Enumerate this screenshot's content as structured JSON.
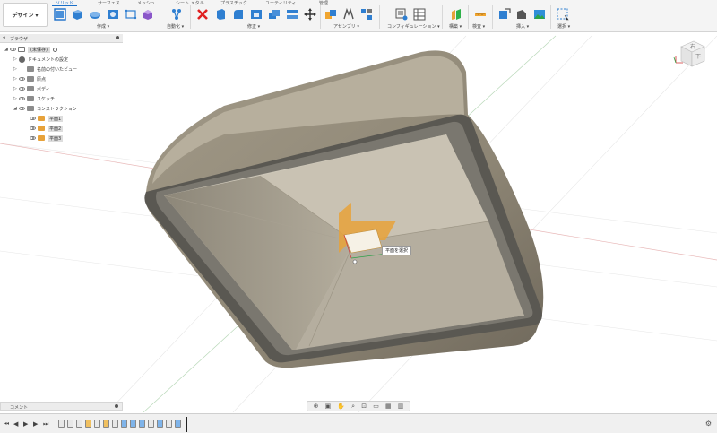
{
  "toolbar": {
    "workspace_label": "デザイン ▾",
    "tabs": [
      "ソリッド",
      "サーフェス",
      "メッシュ",
      "シート メタル",
      "プラスチック",
      "ユーティリティ",
      "管理"
    ],
    "groups": [
      "作成 ▾",
      "自動化 ▾",
      "修正 ▾",
      "アセンブリ ▾",
      "コンフィギュレーション ▾",
      "構築 ▾",
      "検査 ▾",
      "挿入 ▾",
      "選択 ▾"
    ],
    "accent": "#1a6fc9"
  },
  "browser": {
    "title": "ブラウザ",
    "items": [
      {
        "label": "(未保存)",
        "icon": "component-icon"
      },
      {
        "label": "ドキュメントの設定",
        "icon": "gear-icon"
      },
      {
        "label": "名前の付いたビュー",
        "icon": "folder-icon"
      },
      {
        "label": "原点",
        "icon": "folder-icon"
      },
      {
        "label": "ボディ",
        "icon": "folder-icon"
      },
      {
        "label": "スケッチ",
        "icon": "folder-icon"
      },
      {
        "label": "コンストラクション",
        "icon": "folder-icon"
      },
      {
        "label": "平面1",
        "icon": "plane-icon"
      },
      {
        "label": "平面2",
        "icon": "plane-icon"
      },
      {
        "label": "平面3",
        "icon": "plane-icon"
      }
    ]
  },
  "comments": {
    "label": "コメント"
  },
  "tooltip": {
    "text": "平面を選択"
  },
  "viewcube": {
    "top_label": "右",
    "front_label": "下"
  },
  "colors": {
    "body_outer": "#a9a190",
    "body_inner": "#c8c1b2",
    "rim_dark": "#5b5953",
    "plane_orange": "#e7a23a"
  }
}
